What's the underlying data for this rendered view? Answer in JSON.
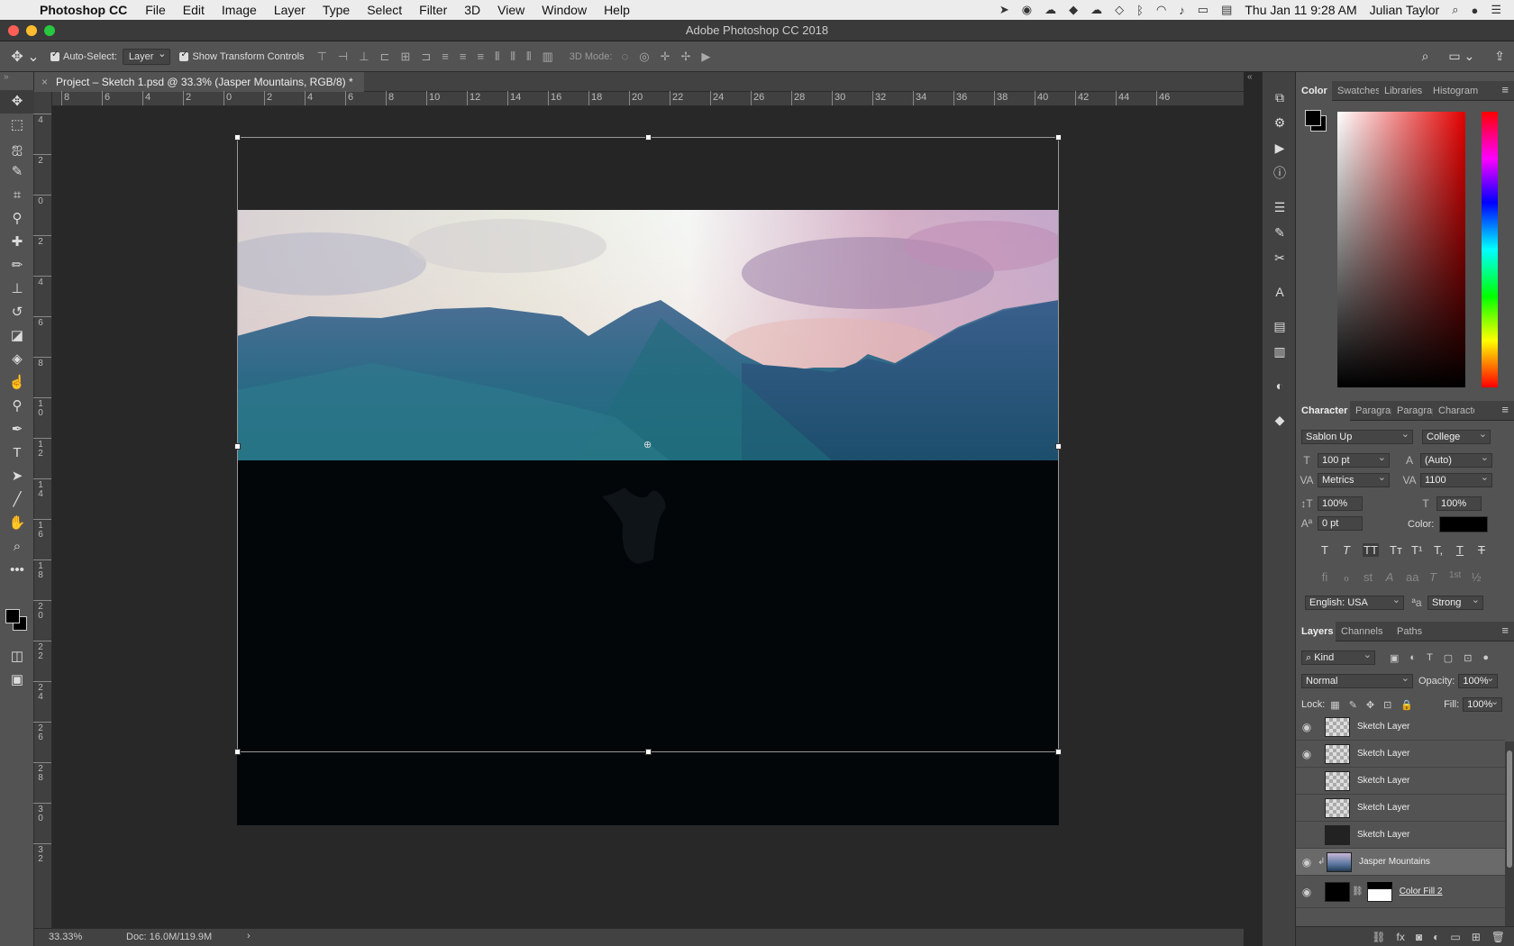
{
  "menubar": {
    "app_name": "Photoshop CC",
    "items": [
      "File",
      "Edit",
      "Image",
      "Layer",
      "Type",
      "Select",
      "Filter",
      "3D",
      "View",
      "Window",
      "Help"
    ],
    "clock": "Thu Jan 11  9:28 AM",
    "user": "Julian Taylor"
  },
  "window": {
    "title": "Adobe Photoshop CC 2018"
  },
  "options_bar": {
    "auto_select_label": "Auto-Select:",
    "auto_select_value": "Layer",
    "transform_label": "Show Transform Controls",
    "three_d_mode_label": "3D Mode:"
  },
  "document": {
    "tab_title": "Project – Sketch 1.psd @ 33.3% (Jasper Mountains, RGB/8) *"
  },
  "rulers": {
    "horizontal": [
      "8",
      "6",
      "4",
      "2",
      "0",
      "2",
      "4",
      "6",
      "8",
      "10",
      "12",
      "14",
      "16",
      "18",
      "20",
      "22",
      "24",
      "26",
      "28",
      "30",
      "32",
      "34",
      "36",
      "38",
      "40",
      "42",
      "44",
      "46"
    ],
    "vertical": [
      "4",
      "2",
      "0",
      "2",
      "4",
      "6",
      "8",
      "1 0",
      "1 2",
      "1 4",
      "1 6",
      "1 8",
      "2 0",
      "2 2",
      "2 4",
      "2 6",
      "2 8",
      "3 0",
      "3 2"
    ]
  },
  "status": {
    "zoom": "33.33%",
    "doc_info": "Doc: 16.0M/119.9M",
    "arrow": "›"
  },
  "color_panel": {
    "tabs": [
      "Color",
      "Swatches",
      "Libraries",
      "Histogram"
    ],
    "active_tab": "Color"
  },
  "character_panel": {
    "tabs": [
      "Character",
      "Paragraph",
      "Paragraph",
      "Character"
    ],
    "font_family": "Sablon Up",
    "font_style": "College",
    "font_size": "100 pt",
    "leading": "(Auto)",
    "kerning": "Metrics",
    "tracking": "1100",
    "vertical_scale": "100%",
    "horizontal_scale": "100%",
    "baseline_shift": "0 pt",
    "color_label": "Color:",
    "language": "English: USA",
    "antialias": "Strong",
    "style_buttons": [
      "T",
      "T",
      "TT",
      "Tт",
      "T¹",
      "T,",
      "T",
      "T"
    ],
    "opentype_buttons": [
      "ﬁ",
      "ℴ",
      "st",
      "A",
      "aa",
      "T",
      "1st",
      "½"
    ]
  },
  "layers_panel": {
    "tabs": [
      "Layers",
      "Channels",
      "Paths"
    ],
    "filter_label": "Kind",
    "blend_mode": "Normal",
    "opacity_label": "Opacity:",
    "opacity": "100%",
    "lock_label": "Lock:",
    "fill_label": "Fill:",
    "fill": "100%",
    "layers": [
      {
        "name": "Sketch Layer",
        "visible": true,
        "thumb": "checker"
      },
      {
        "name": "Sketch Layer",
        "visible": true,
        "thumb": "checker"
      },
      {
        "name": "Sketch Layer",
        "visible": false,
        "thumb": "checker"
      },
      {
        "name": "Sketch Layer",
        "visible": false,
        "thumb": "checker"
      },
      {
        "name": "Sketch Layer",
        "visible": false,
        "thumb": "dark"
      },
      {
        "name": "Jasper Mountains",
        "visible": true,
        "thumb": "mount",
        "selected": true
      },
      {
        "name": "Color Fill 2",
        "visible": true,
        "thumb": "black"
      }
    ]
  }
}
